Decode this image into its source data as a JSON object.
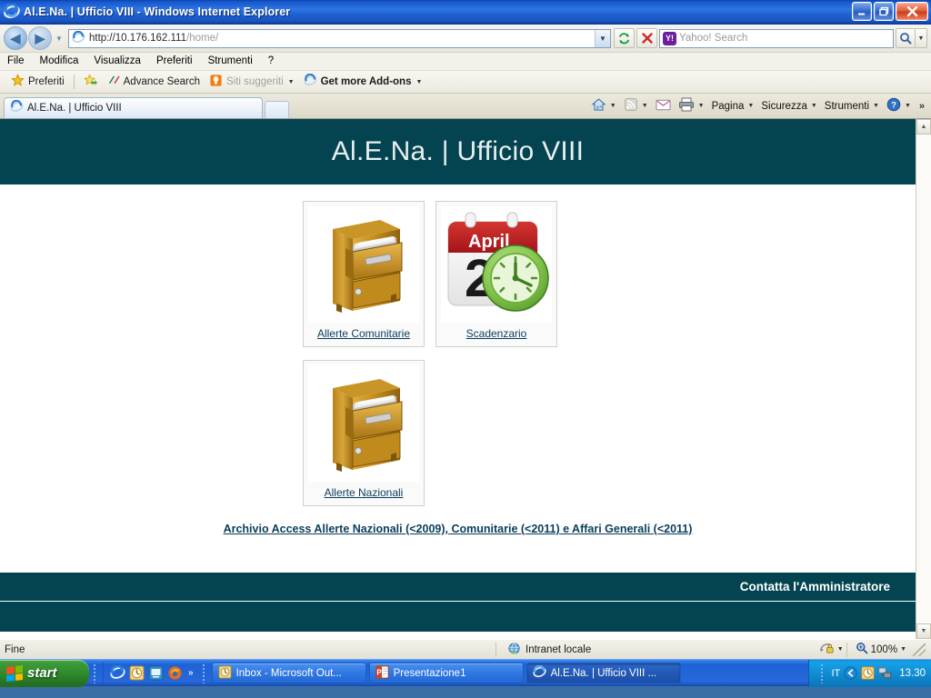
{
  "window": {
    "title": "Al.E.Na. | Ufficio VIII - Windows Internet Explorer",
    "minimize_label": "_",
    "maximize_label": "❐",
    "close_label": "✕"
  },
  "navbar": {
    "back_label": "◀",
    "forward_label": "▶",
    "history_caret": "▼",
    "address_value": "http://10.176.162.111/home/",
    "address_value_bold": "http://10.176.162.111",
    "address_value_dim": "/home/",
    "address_dropdown_caret": "▼",
    "refresh_label": "↻",
    "stop_label": "✕",
    "search_placeholder": "Yahoo! Search",
    "search_provider_icon": "yahoo-icon",
    "search_provider_mark": "Y!",
    "search_go_icon": "magnifier-icon",
    "search_go_caret": "▼"
  },
  "menubar": {
    "items": [
      {
        "label": "File"
      },
      {
        "label": "Modifica"
      },
      {
        "label": "Visualizza"
      },
      {
        "label": "Preferiti"
      },
      {
        "label": "Strumenti"
      },
      {
        "label": "?"
      }
    ]
  },
  "favbar": {
    "favorites_label": "Preferiti",
    "favorites_icon": "star-icon",
    "add_icon": "star-add-icon",
    "items": [
      {
        "label": "Advance Search",
        "icon": "alitalia-icon",
        "caret": "",
        "bold": false,
        "dim": false
      },
      {
        "label": "Siti suggeriti",
        "icon": "bulb-icon",
        "caret": "▼",
        "bold": false,
        "dim": true
      },
      {
        "label": "Get more Add-ons",
        "icon": "ie-icon",
        "caret": "▼",
        "bold": true,
        "dim": false
      }
    ]
  },
  "tabs": {
    "items": [
      {
        "label": "Al.E.Na. | Ufficio VIII",
        "icon": "ie-icon",
        "active": true
      }
    ],
    "new_tab_label": ""
  },
  "commandbar": {
    "items": [
      {
        "label": "",
        "icon": "home-icon",
        "caret": "▼"
      },
      {
        "label": "",
        "icon": "rss-icon",
        "caret": "▼"
      },
      {
        "label": "",
        "icon": "mail-icon",
        "caret": ""
      },
      {
        "label": "",
        "icon": "print-icon",
        "caret": "▼"
      },
      {
        "label": "Pagina",
        "icon": "",
        "caret": "▼"
      },
      {
        "label": "Sicurezza",
        "icon": "",
        "caret": "▼"
      },
      {
        "label": "Strumenti",
        "icon": "",
        "caret": "▼"
      },
      {
        "label": "",
        "icon": "help-icon",
        "caret": "▼"
      }
    ],
    "overflow_label": "»"
  },
  "page": {
    "header_title": "Al.E.Na.  |  Ufficio VIII",
    "header_color": "#044450",
    "link_color": "#0b3d5c",
    "tiles": [
      {
        "label": "Allerte Comunitarie",
        "icon": "filing-cabinet-icon"
      },
      {
        "label": "Scadenzario",
        "icon": "calendar-clock-icon",
        "calendar_month": "April",
        "calendar_day": "20"
      },
      {
        "label": "Allerte Nazionali",
        "icon": "filing-cabinet-icon"
      }
    ],
    "archive_link": "Archivio Access Allerte Nazionali (<2009), Comunitarie (<2011) e Affari Generali (<2011)",
    "footer_link": "Contatta l'Amministratore"
  },
  "scrollbar": {
    "up_label": "▲",
    "down_label": "▼"
  },
  "statusbar": {
    "status_text": "Fine",
    "zone_label": "Intranet locale",
    "zone_icon": "globe-icon",
    "protected_icon": "lock-icon",
    "protected_caret": "▼",
    "zoom_icon": "zoom-icon",
    "zoom_level": "100%",
    "zoom_caret": "▼"
  },
  "taskbar": {
    "start_label": "start",
    "quicklaunch": [
      {
        "icon": "ie-icon"
      },
      {
        "icon": "outlook-icon"
      },
      {
        "icon": "show-desktop-icon"
      },
      {
        "icon": "firefox-icon"
      }
    ],
    "quicklaunch_overflow": "»",
    "tasks": [
      {
        "label": "Inbox - Microsoft Out...",
        "icon": "outlook-icon",
        "active": false
      },
      {
        "label": "Presentazione1",
        "icon": "powerpoint-icon",
        "active": false
      },
      {
        "label": "Al.E.Na. | Ufficio VIII ...",
        "icon": "ie-icon",
        "active": true
      }
    ],
    "tray_language": "IT",
    "tray_icons": [
      {
        "icon": "messenger-icon"
      },
      {
        "icon": "clock-icon"
      },
      {
        "icon": "network-icon"
      }
    ],
    "clock": "13.30"
  }
}
